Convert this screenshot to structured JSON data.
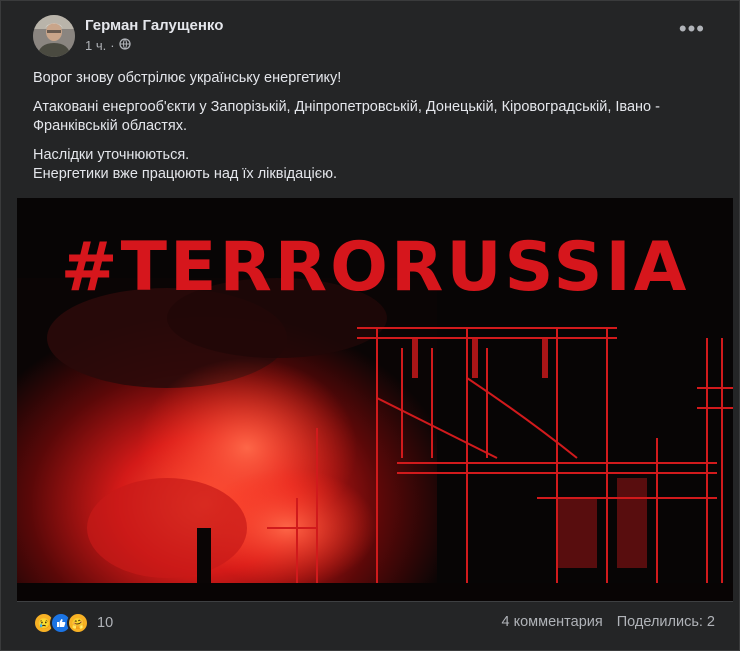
{
  "post": {
    "author": "Герман Галущенко",
    "time": "1 ч.",
    "privacy_icon": "globe-icon",
    "more_icon": "more-dots-icon",
    "paragraphs": [
      "Ворог знову обстрілює українську енергетику!",
      "Атаковані енергооб'єкти у Запорізькій, Дніпропетровській, Донецькій, Кіровоградській, Івано - Франківській областях.",
      "Наслідки уточнюються.",
      "Енергетики вже працюють над їх ліквідацією."
    ]
  },
  "image": {
    "headline": "#TERRORUSSIA",
    "accent": "#d6161c"
  },
  "footer": {
    "reaction_icons": [
      "sad",
      "like",
      "care"
    ],
    "reaction_count": "10",
    "comments": "4 комментария",
    "shares": "Поделились: 2"
  }
}
